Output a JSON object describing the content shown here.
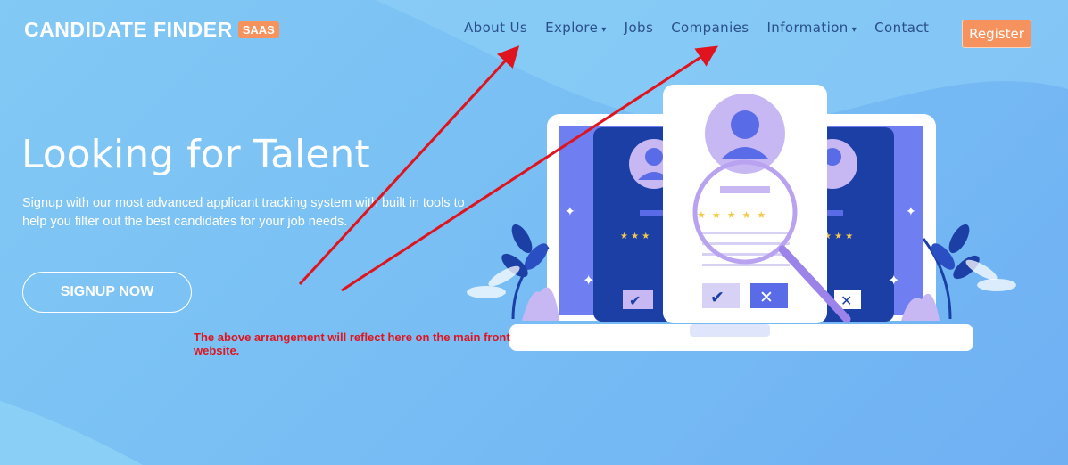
{
  "brand": {
    "name": "CANDIDATE FINDER",
    "badge": "SAAS"
  },
  "nav": {
    "items": [
      {
        "label": "About Us",
        "has_dropdown": false
      },
      {
        "label": "Explore",
        "has_dropdown": true
      },
      {
        "label": "Jobs",
        "has_dropdown": false
      },
      {
        "label": "Companies",
        "has_dropdown": false
      },
      {
        "label": "Information",
        "has_dropdown": true
      },
      {
        "label": "Contact",
        "has_dropdown": false
      }
    ],
    "register_label": "Register",
    "caret": "▾"
  },
  "hero": {
    "title": "Looking for Talent",
    "subtitle": "Signup with our most advanced applicant tracking system with built in tools to help you filter out the best candidates for your job needs.",
    "cta_label": "SIGNUP NOW"
  },
  "annotation": {
    "text": "The above arrangement will reflect here on the main front website."
  },
  "colors": {
    "accent": "#f5925d",
    "nav_text": "#2a4f8a",
    "arrow": "#e0141e",
    "card_dark": "#1c3fa6"
  },
  "icons": {
    "check": "✔",
    "cross": "✕",
    "star": "★",
    "sparkle": "✦"
  }
}
